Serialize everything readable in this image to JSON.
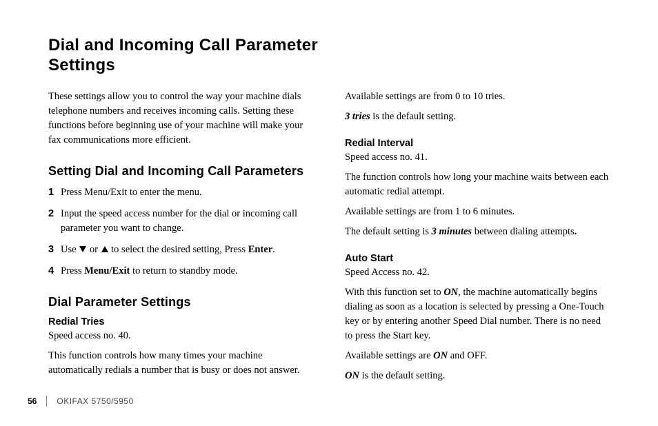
{
  "title": "Dial and Incoming Call Parameter Settings",
  "intro": "These settings allow you to control the way your machine dials telephone numbers and receives incoming calls. Setting these functions before beginning use of your machine will make your fax communications more efficient.",
  "s1": {
    "heading": "Setting Dial and Incoming Call Parameters",
    "steps": {
      "n1": "1",
      "t1": "Press Menu/Exit to enter the menu.",
      "n2": "2",
      "t2": "Input the speed access number for the dial or incoming call parameter you want to change.",
      "n3": "3",
      "t3a": "Use ",
      "t3b": " or ",
      "t3c": " to select the desired setting,  Press ",
      "t3enter": "Enter",
      "t3d": ".",
      "n4": "4",
      "t4a": "Press ",
      "t4b": "Menu/Exit",
      "t4c": " to return to standby mode."
    }
  },
  "s2": {
    "heading": "Dial Parameter Settings",
    "redial_tries": {
      "heading": "Redial Tries",
      "p1": "Speed access no. 40.",
      "p2": "This function controls how many times your machine automatically redials a number that is busy or does not answer."
    }
  },
  "col2": {
    "avail": "Available settings are from 0 to 10 tries.",
    "default_a": "3 tries",
    "default_b": " is the default setting.",
    "redial_interval": {
      "heading": "Redial Interval",
      "p1": "Speed access no. 41.",
      "p2": "The function controls how long your machine waits between each automatic redial attempt.",
      "p3": "Available settings are from 1 to 6 minutes.",
      "p4a": "The default setting is ",
      "p4b": "3 minutes",
      "p4c": " between dialing attempts",
      "p4d": "."
    },
    "auto_start": {
      "heading": "Auto Start",
      "p1": "Speed Access no. 42.",
      "p2a": "With this function set to ",
      "p2b": "ON",
      "p2c": ", the machine automatically begins dialing as soon as a location is selected by pressing a One-Touch key or by entering another Speed Dial number. There is no need to press the Start key.",
      "p3a": "Available settings are ",
      "p3b": "ON",
      "p3c": " and OFF.",
      "p4a": "ON",
      "p4b": " is the default setting."
    }
  },
  "footer": {
    "page": "56",
    "product": "OKIFAX 5750/5950"
  }
}
